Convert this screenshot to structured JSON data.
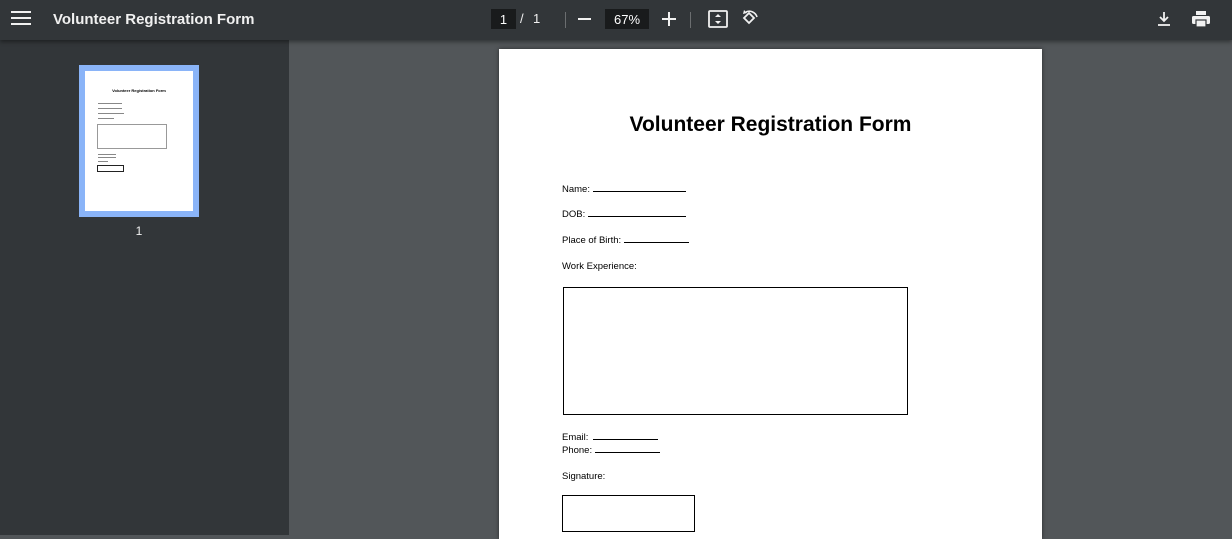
{
  "toolbar": {
    "title": "Volunteer Registration Form",
    "current_page": "1",
    "page_separator": "/",
    "total_pages": "1",
    "zoom": "67%"
  },
  "sidebar": {
    "thumbnail_label": "1",
    "thumbnail_title": "Volunteer Registration Form"
  },
  "document": {
    "title": "Volunteer Registration Form",
    "fields": {
      "name": "Name:",
      "dob": "DOB:",
      "place_of_birth": "Place of Birth:",
      "work_experience": "Work Experience:",
      "email": "Email:",
      "phone": "Phone:",
      "signature": "Signature:"
    }
  },
  "colors": {
    "toolbar_bg": "#323639",
    "viewer_bg": "#525659",
    "thumb_highlight": "#8ab4f8"
  },
  "icons": [
    "menu-icon",
    "zoom-out-icon",
    "zoom-in-icon",
    "fit-to-page-icon",
    "rotate-icon",
    "download-icon",
    "print-icon"
  ]
}
